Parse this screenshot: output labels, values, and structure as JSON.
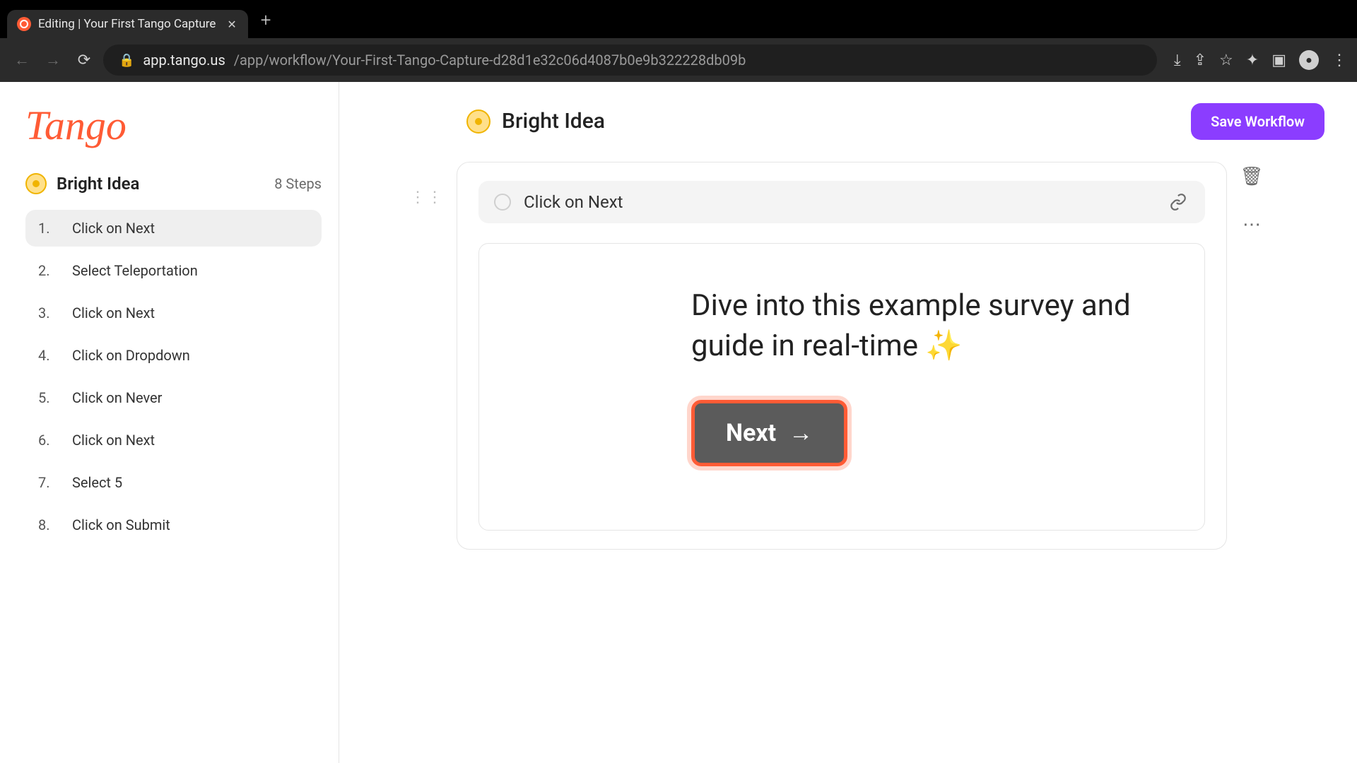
{
  "browser": {
    "tab_title": "Editing | Your First Tango Capture",
    "url_host": "app.tango.us",
    "url_path": "/app/workflow/Your-First-Tango-Capture-d28d1e32c06d4087b0e9b322228db09b"
  },
  "sidebar": {
    "logo_text": "Tango",
    "workflow_name": "Bright Idea",
    "step_count_label": "8 Steps",
    "steps": [
      {
        "n": "1.",
        "label": "Click on Next",
        "active": true
      },
      {
        "n": "2.",
        "label": "Select Teleportation"
      },
      {
        "n": "3.",
        "label": "Click on Next"
      },
      {
        "n": "4.",
        "label": "Click on Dropdown"
      },
      {
        "n": "5.",
        "label": "Click on Never"
      },
      {
        "n": "6.",
        "label": "Click on Next"
      },
      {
        "n": "7.",
        "label": "Select 5"
      },
      {
        "n": "8.",
        "label": "Click on Submit"
      }
    ]
  },
  "header": {
    "title": "Bright Idea",
    "save_label": "Save Workflow"
  },
  "editor": {
    "step_title": "Click on Next",
    "screenshot_caption": "Dive into this example survey and\nguide in real-time ✨",
    "next_button_label": "Next"
  }
}
